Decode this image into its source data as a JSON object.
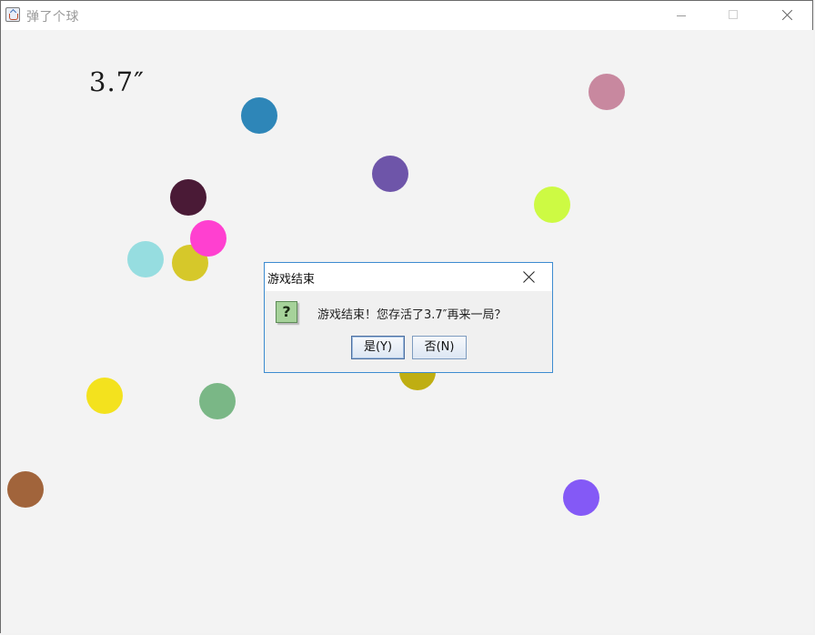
{
  "window": {
    "title": "弹了个球",
    "icon": "java-cup-icon"
  },
  "game": {
    "timer_text": "3.7″",
    "balls": [
      {
        "color": "#2e86b8",
        "pos": "upper"
      },
      {
        "color": "#c8889f",
        "pos": "upper-right"
      },
      {
        "color": "#6e55a9",
        "pos": "upper-middle"
      },
      {
        "color": "#4a1a36",
        "pos": "left"
      },
      {
        "color": "#cdfa43",
        "pos": "right"
      },
      {
        "color": "#ff40d0",
        "pos": "left"
      },
      {
        "color": "#96dde0",
        "pos": "left"
      },
      {
        "color": "#d6c82a",
        "pos": "left"
      },
      {
        "color": "#bfae12",
        "pos": "center"
      },
      {
        "color": "#f3e21e",
        "pos": "lower-left"
      },
      {
        "color": "#7ab786",
        "pos": "lower-left"
      },
      {
        "color": "#a1643b",
        "pos": "bottom-left"
      },
      {
        "color": "#8459f6",
        "pos": "bottom-right"
      }
    ]
  },
  "dialog": {
    "title": "游戏结束",
    "icon": "question-icon",
    "icon_glyph": "?",
    "message": "游戏结束！您存活了3.7″再来一局？",
    "yes_label": "是(Y)",
    "no_label": "否(N)"
  }
}
